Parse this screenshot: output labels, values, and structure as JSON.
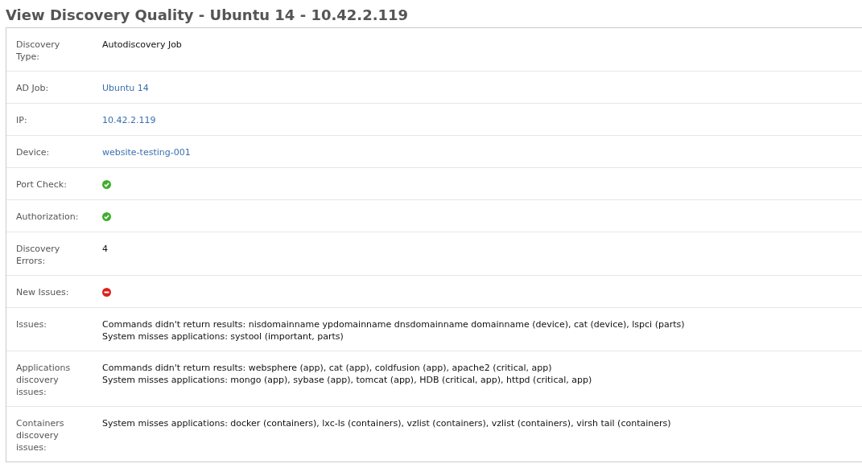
{
  "title": "View Discovery Quality - Ubuntu 14 - 10.42.2.119",
  "rows": [
    {
      "label": "Discovery Type:",
      "kind": "text",
      "value": "Autodiscovery Job"
    },
    {
      "label": "AD Job:",
      "kind": "link",
      "value": "Ubuntu 14"
    },
    {
      "label": "IP:",
      "kind": "link",
      "value": "10.42.2.119"
    },
    {
      "label": "Device:",
      "kind": "link",
      "value": "website-testing-001"
    },
    {
      "label": "Port Check:",
      "kind": "status",
      "passed": true
    },
    {
      "label": "Authorization:",
      "kind": "status",
      "passed": true
    },
    {
      "label": "Discovery Errors:",
      "kind": "text",
      "value": "4"
    },
    {
      "label": "New Issues:",
      "kind": "status",
      "passed": false
    },
    {
      "label": "Issues:",
      "kind": "lines",
      "lines": [
        "Commands didn't return results: nisdomainname ypdomainname dnsdomainname domainname (device), cat (device), lspci (parts)",
        "System misses applications: systool (important, parts)"
      ]
    },
    {
      "label": "Applications discovery issues:",
      "kind": "lines",
      "lines": [
        "Commands didn't return results: websphere (app), cat (app), coldfusion (app), apache2 (critical, app)",
        "System misses applications: mongo (app), sybase (app), tomcat (app), HDB (critical, app), httpd (critical, app)"
      ]
    },
    {
      "label": "Containers discovery issues:",
      "kind": "lines",
      "lines": [
        "System misses applications: docker (containers), lxc-ls (containers), vzlist (containers), vzlist (containers), virsh tail (containers)"
      ]
    }
  ]
}
